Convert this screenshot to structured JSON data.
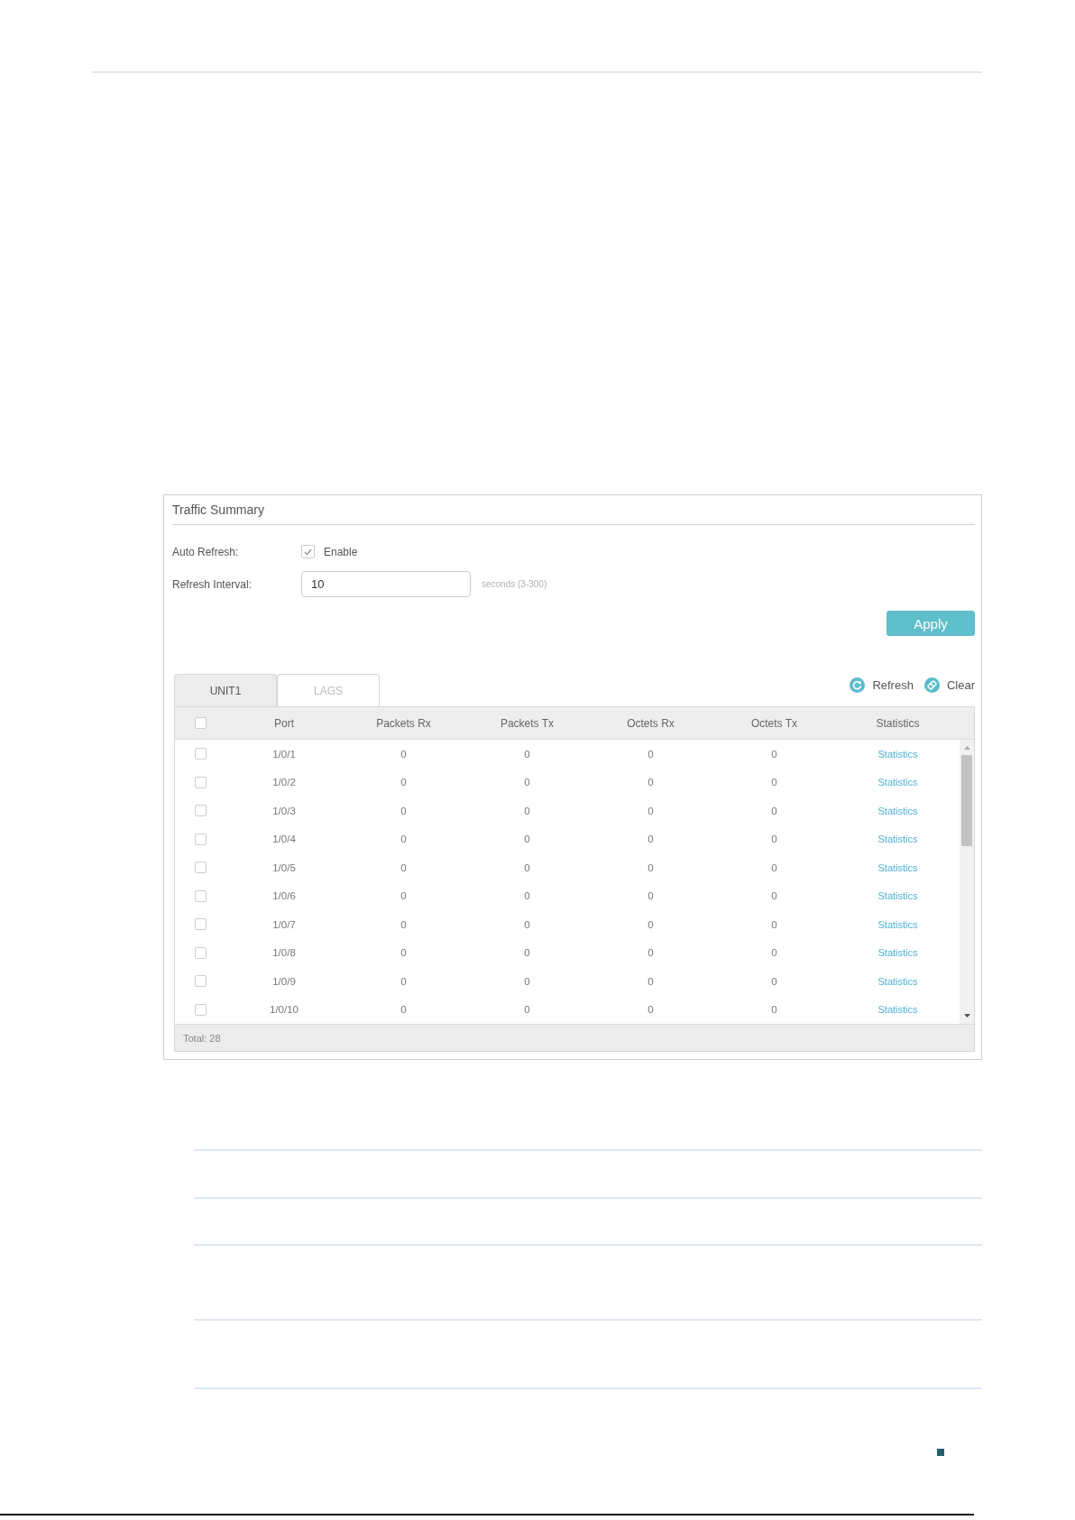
{
  "panel": {
    "title": "Traffic Summary"
  },
  "form": {
    "auto_refresh": {
      "label": "Auto Refresh:",
      "option": "Enable",
      "checked": true
    },
    "refresh_interval": {
      "label": "Refresh Interval:",
      "value": "10",
      "hint": "seconds (3-300)"
    },
    "apply_button": "Apply"
  },
  "tabs": [
    {
      "label": "UNIT1",
      "selected": true
    },
    {
      "label": "LAGS",
      "selected": false
    }
  ],
  "actions": [
    {
      "kind": "refresh",
      "label": "Refresh"
    },
    {
      "kind": "clear",
      "label": "Clear"
    }
  ],
  "table": {
    "select_all": {
      "checked": false
    },
    "columns": [
      "Port",
      "Packets Rx",
      "Packets Tx",
      "Octets Rx",
      "Octets Tx",
      "Statistics"
    ],
    "rows": [
      {
        "checked": false,
        "cells": [
          "1/0/1",
          "0",
          "0",
          "0",
          "0"
        ],
        "link": "Statistics"
      },
      {
        "checked": false,
        "cells": [
          "1/0/2",
          "0",
          "0",
          "0",
          "0"
        ],
        "link": "Statistics"
      },
      {
        "checked": false,
        "cells": [
          "1/0/3",
          "0",
          "0",
          "0",
          "0"
        ],
        "link": "Statistics"
      },
      {
        "checked": false,
        "cells": [
          "1/0/4",
          "0",
          "0",
          "0",
          "0"
        ],
        "link": "Statistics"
      },
      {
        "checked": false,
        "cells": [
          "1/0/5",
          "0",
          "0",
          "0",
          "0"
        ],
        "link": "Statistics"
      },
      {
        "checked": false,
        "cells": [
          "1/0/6",
          "0",
          "0",
          "0",
          "0"
        ],
        "link": "Statistics"
      },
      {
        "checked": false,
        "cells": [
          "1/0/7",
          "0",
          "0",
          "0",
          "0"
        ],
        "link": "Statistics"
      },
      {
        "checked": false,
        "cells": [
          "1/0/8",
          "0",
          "0",
          "0",
          "0"
        ],
        "link": "Statistics"
      },
      {
        "checked": false,
        "cells": [
          "1/0/9",
          "0",
          "0",
          "0",
          "0"
        ],
        "link": "Statistics"
      },
      {
        "checked": false,
        "cells": [
          "1/0/10",
          "0",
          "0",
          "0",
          "0"
        ],
        "link": "Statistics"
      }
    ],
    "total": "Total: 28"
  }
}
